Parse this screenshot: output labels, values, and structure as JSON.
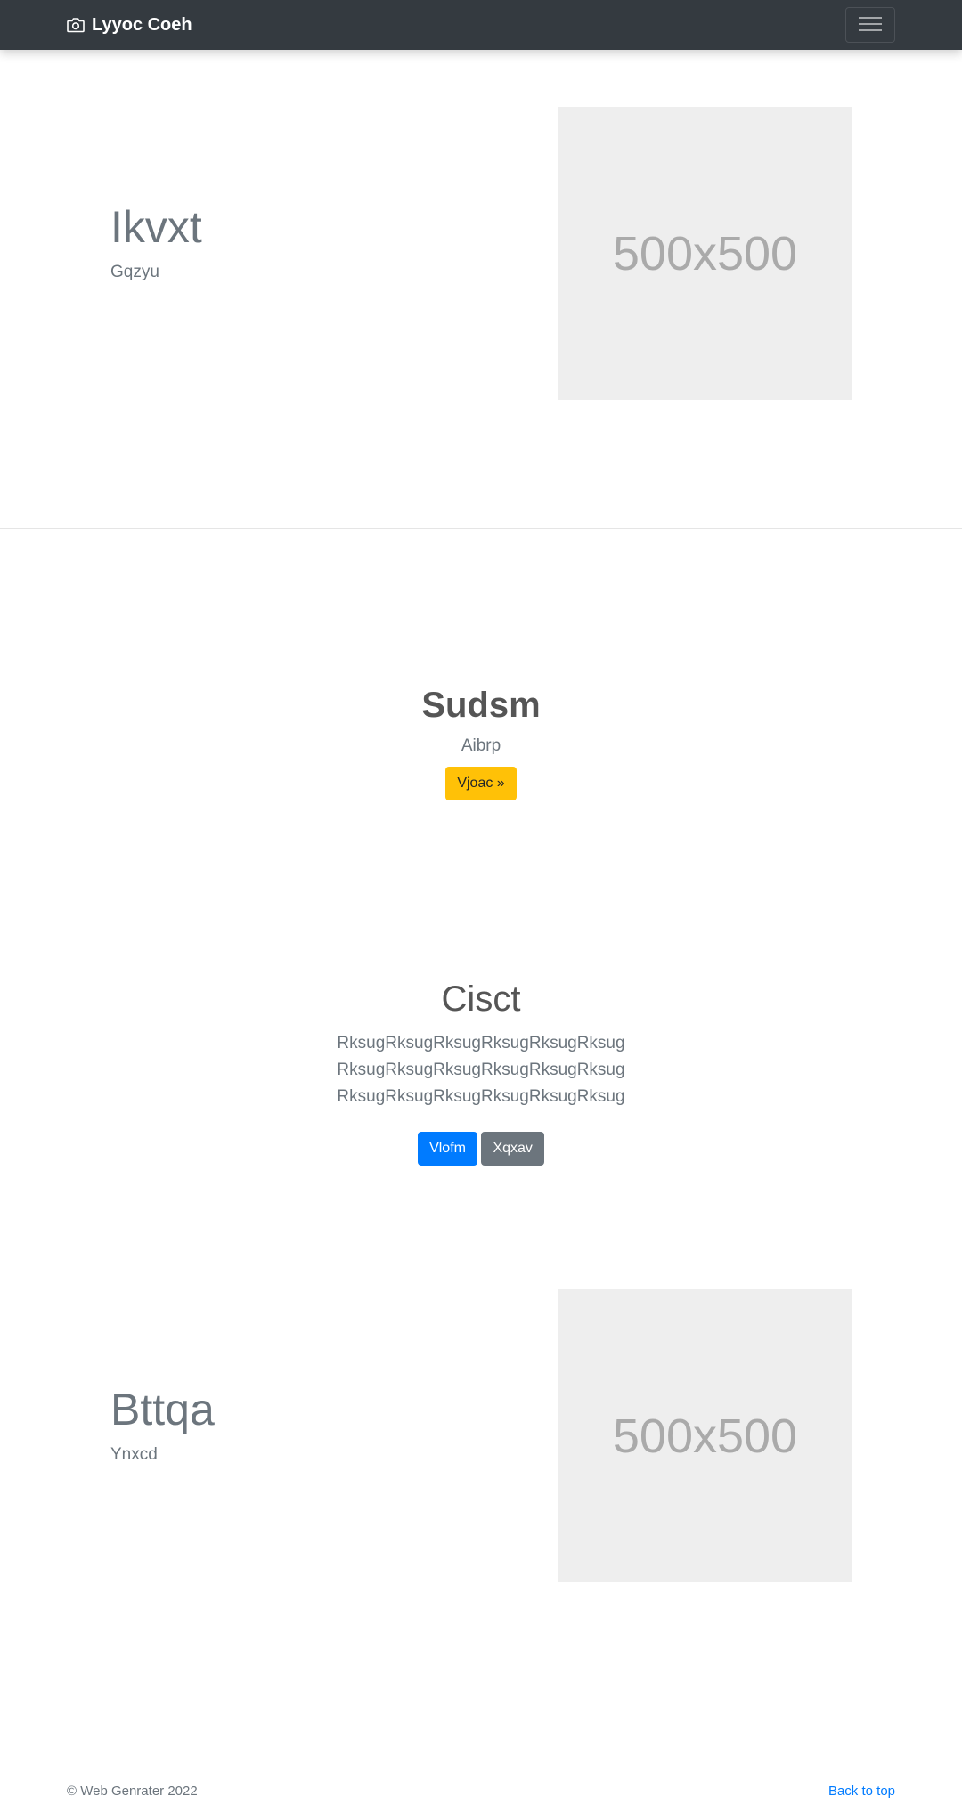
{
  "navbar": {
    "brand": "Lyyoc Coeh",
    "brand_icon": "camera-icon",
    "toggler_icon": "hamburger-menu-icon"
  },
  "feature1": {
    "title": "Ikvxt",
    "subtitle": "Gqzyu",
    "image_label": "500x500"
  },
  "section2": {
    "title": "Sudsm",
    "subtitle": "Aibrp",
    "button": "Vjoac »"
  },
  "section3": {
    "title": "Cisct",
    "text": "RksugRksugRksugRksugRksugRksug RksugRksugRksugRksugRksugRksug RksugRksugRksugRksugRksugRksug",
    "primary_button": "Vlofm",
    "secondary_button": "Xqxav"
  },
  "feature2": {
    "title": "Bttqa",
    "subtitle": "Ynxcd",
    "image_label": "500x500"
  },
  "footer": {
    "copyright": "© Web Genrater 2022",
    "back_to_top": "Back to top"
  },
  "colors": {
    "navbar_bg": "#343a40",
    "warning": "#ffc107",
    "primary": "#007bff",
    "secondary": "#6c757d"
  }
}
